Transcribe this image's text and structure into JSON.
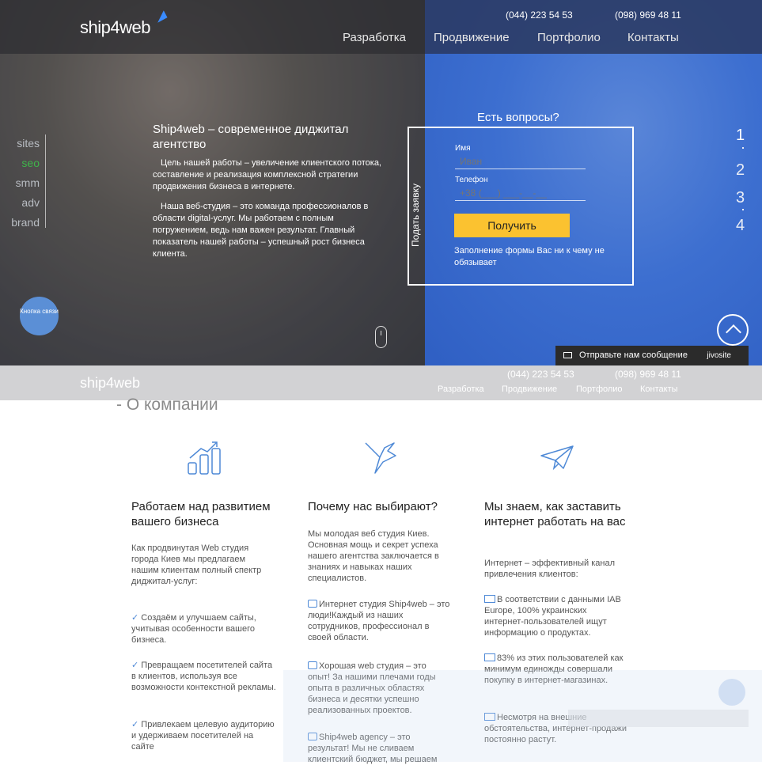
{
  "header": {
    "logo": "ship4web",
    "phones": [
      "(044) 223 54 53",
      "(098) 969 48 11"
    ],
    "nav": [
      "Разработка",
      "Продвижение",
      "Портфолио",
      "Контакты"
    ]
  },
  "sidemenu": {
    "items": [
      "sites",
      "seo",
      "smm",
      "adv",
      "brand"
    ],
    "active": "seo"
  },
  "intro": {
    "title": "Ship4web – современное диджитал агентство",
    "p1": "Цель нашей работы – увеличение клиентского потока, составление и реализация комплексной стратегии продвижения бизнеса в интернете.",
    "p2": "Наша веб-студия – это команда профессионалов в области digital-услуг. Мы работаем с полным погружением, ведь нам важен результат. Главный показатель нашей работы – успешный рост бизнеса клиента."
  },
  "call_button": "Кнопка связи",
  "form": {
    "title": "Есть вопросы?",
    "vertical_label": "Подать заявку",
    "name_label": "Имя",
    "name_placeholder": "Иван",
    "phone_label": "Телефон",
    "phone_placeholder": "+38 (___) ___-__-__",
    "submit": "Получить",
    "note": "Заполнение формы Вас ни к чему не обязывает"
  },
  "pager": [
    "1",
    "2",
    "3",
    "4"
  ],
  "chat": {
    "label": "Отправьте нам сообщение",
    "brand": "jivosite"
  },
  "sticky": {
    "logo": "ship4web",
    "phones": [
      "(044) 223 54 53",
      "(098) 969 48 11"
    ],
    "nav": [
      "Разработка",
      "Продвижение",
      "Портфолио",
      "Контакты"
    ]
  },
  "about": {
    "title": "- О компании",
    "columns": [
      {
        "icon": "growth-chart-icon",
        "heading": "Работаем над развитием вашего бизнеса",
        "intro": "Как продвинутая Web студия города Киев мы предлагаем нашим клиентам полный спектр диджитал-услуг:",
        "items": [
          "Создаём и улучшаем сайты, учитывая особенности вашего бизнеса.",
          "Превращаем посетителей сайта в клиентов, используя все возможности контекстной рекламы.",
          "Привлекаем целевую аудиторию и удерживаем посетителей на сайте"
        ]
      },
      {
        "icon": "origami-bird-icon",
        "heading": "Почему нас выбирают?",
        "intro": "Мы молодая веб студия Киев. Основная мощь и секрет успеха нашего агентства заключается в знаниях и навыках наших специалистов.",
        "items": [
          "Интернет студия Ship4web – это люди!Каждый из наших сотрудников, профессионал в своей области.",
          "Хорошая web студия – это опыт! За нашими плечами годы опыта в различных областях бизнеса и десятки успешно реализованных проектов.",
          "Ship4web agency – это результат! Мы не сливаем клиентский бюджет, мы решаем"
        ]
      },
      {
        "icon": "paper-plane-icon",
        "heading": "Мы знаем, как заставить интернет работать на вас",
        "intro": "Интернет – эффективный канал привлечения клиентов:",
        "items": [
          "В соответствии с данными IAB Europe, 100% украинских интернет-пользователей ищут информацию о продуктах.",
          "83% из этих пользователей как минимум единожды совершали покупку в интернет-магазинах.",
          "Несмотря на внешние обстоятельства, интернет-продажи постоянно растут."
        ]
      }
    ]
  }
}
